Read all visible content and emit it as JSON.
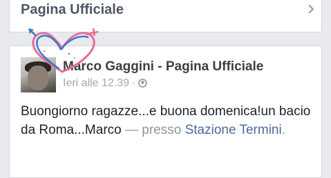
{
  "top_card": {
    "title": "Pagina Ufficiale"
  },
  "post": {
    "author": "Marco Gaggini - Pagina Ufficiale",
    "time": "Ieri alle 12.39",
    "separator": "·",
    "text_main": "Buongiorno ragazze...e buona domenica!un bacio da Roma...Marco",
    "text_presso": " — presso ",
    "location": "Stazione Termini",
    "text_end": "."
  },
  "icons": {
    "chevron": "chevron-right-icon",
    "privacy": "globe-icon",
    "watermark": "heart-logo-icon"
  },
  "colors": {
    "background": "#e9eaed",
    "card": "#ffffff",
    "link": "#4b6b9a",
    "muted": "#90949c",
    "watermark_pink": "#e86a9a",
    "watermark_blue": "#3a78c8"
  }
}
